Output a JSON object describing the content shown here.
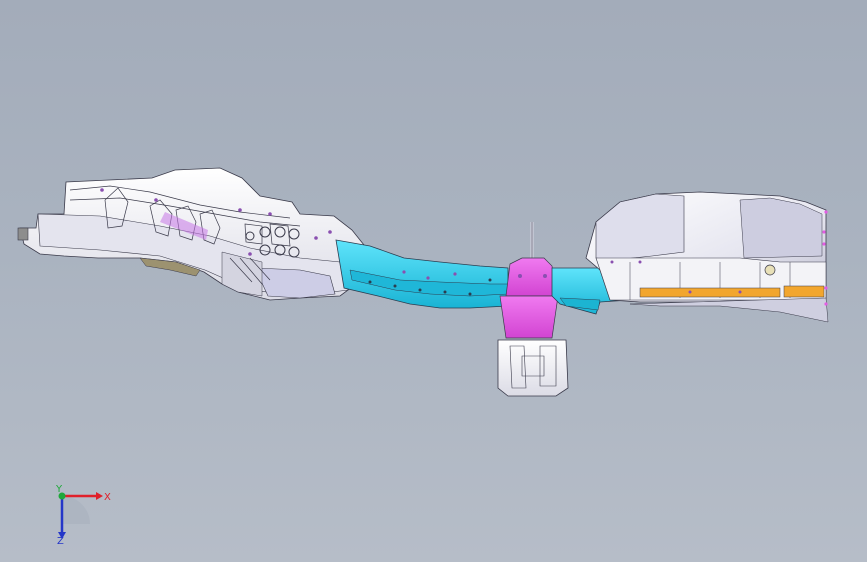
{
  "viewport": {
    "background_top": "#a3acba",
    "background_bottom": "#b6bdc8"
  },
  "model": {
    "colors": {
      "white_body": "#f1f1f5",
      "shadow": "#c9c9d6",
      "lavender": "#cdcde6",
      "cyan": "#33d6f2",
      "cyan_dark": "#1cb4d2",
      "magenta": "#e35ce3",
      "orange": "#f2a62e",
      "edge": "#3a3a4a",
      "hole": "#8a4fb0"
    }
  },
  "triad": {
    "x_label": "X",
    "y_label": "Y",
    "z_label": "Z",
    "x_color": "#e0202a",
    "y_color": "#1fa83a",
    "z_color": "#2436c8"
  }
}
